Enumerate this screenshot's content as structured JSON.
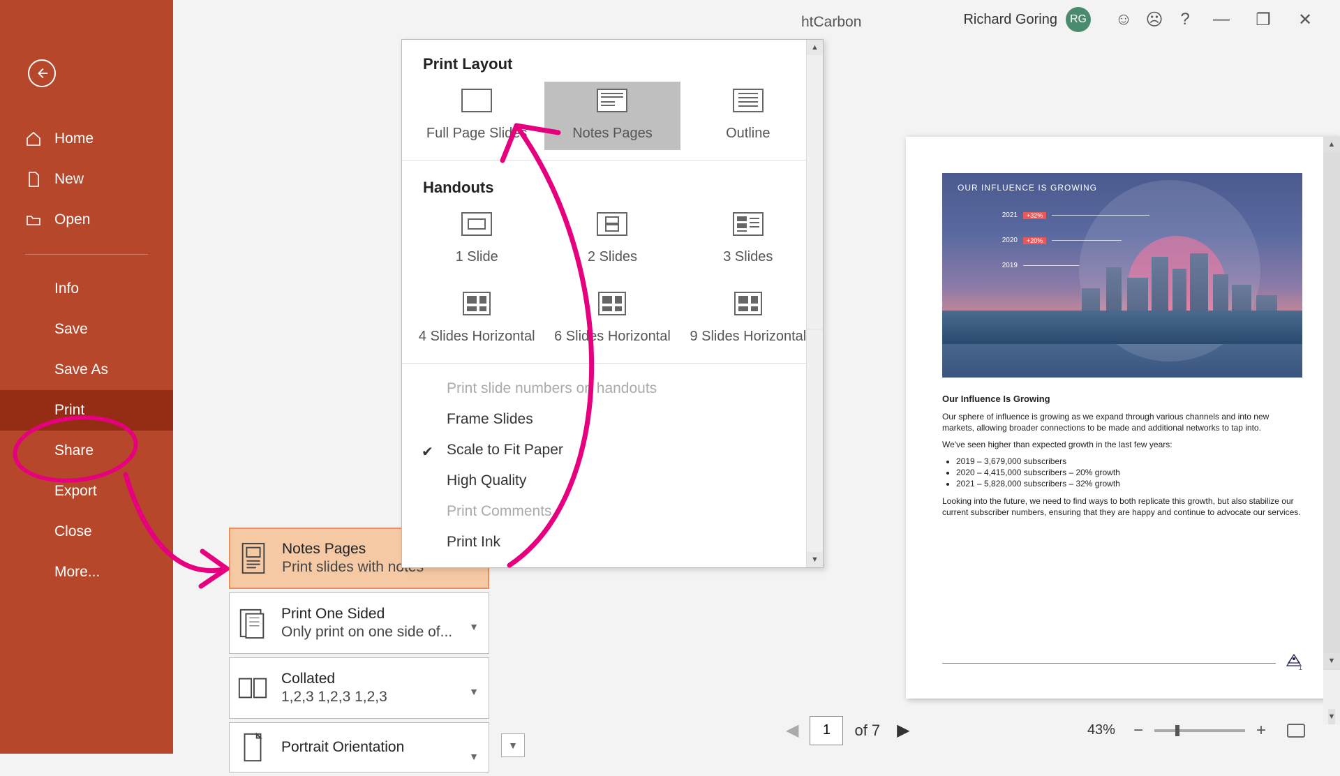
{
  "titlebar": {
    "doc_title": "htCarbon",
    "user_name": "Richard Goring",
    "user_initials": "RG"
  },
  "sidebar": {
    "home": "Home",
    "new": "New",
    "open": "Open",
    "info": "Info",
    "save": "Save",
    "save_as": "Save As",
    "print": "Print",
    "share": "Share",
    "export": "Export",
    "close": "Close",
    "more": "More..."
  },
  "dropdown": {
    "section_layout": "Print Layout",
    "opt_full": "Full Page Slides",
    "opt_notes": "Notes Pages",
    "opt_outline": "Outline",
    "section_handouts": "Handouts",
    "opt_1": "1 Slide",
    "opt_2": "2 Slides",
    "opt_3": "3 Slides",
    "opt_4h": "4 Slides Horizontal",
    "opt_6h": "6 Slides Horizontal",
    "opt_9h": "9 Slides Horizontal",
    "item_num": "Print slide numbers on handouts",
    "item_frame": "Frame Slides",
    "item_scale": "Scale to Fit Paper",
    "item_hq": "High Quality",
    "item_comments": "Print Comments",
    "item_ink": "Print Ink"
  },
  "settings": {
    "notes": {
      "line1": "Notes Pages",
      "line2": "Print slides with notes"
    },
    "sided": {
      "line1": "Print One Sided",
      "line2": "Only print on one side of..."
    },
    "collated": {
      "line1": "Collated",
      "line2": "1,2,3    1,2,3    1,2,3"
    },
    "orient": {
      "line1": "Portrait Orientation"
    }
  },
  "preview": {
    "slide_title": "OUR INFLUENCE IS GROWING",
    "bars": [
      {
        "year": "2021",
        "pill": "+32%"
      },
      {
        "year": "2020",
        "pill": "+20%"
      },
      {
        "year": "2019",
        "pill": ""
      }
    ],
    "notes": {
      "heading": "Our Influence Is Growing",
      "p1": "Our sphere of influence is growing as we expand through various channels and into new markets, allowing broader connections to be made and additional networks to tap into.",
      "p2": "We've seen higher than expected growth in the last few years:",
      "bul1": "2019 – 3,679,000 subscribers",
      "bul2": "2020 – 4,415,000 subscribers – 20% growth",
      "bul3": "2021 – 5,828,000 subscribers – 32% growth",
      "p3": "Looking into the future, we need to find ways to both replicate this growth, but also stabilize our current subscriber numbers, ensuring that they are happy and continue to advocate our services."
    },
    "page_num": "1"
  },
  "nav": {
    "current": "1",
    "total": "of 7",
    "zoom": "43%"
  }
}
